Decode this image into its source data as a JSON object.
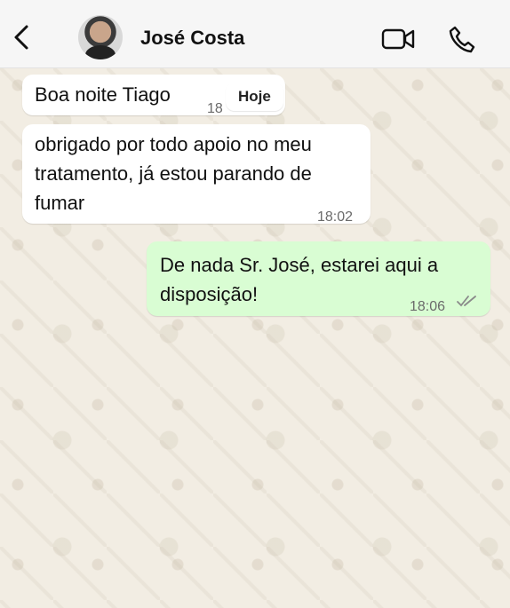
{
  "header": {
    "contact_name": "José Costa",
    "back_icon": "chevron-left-icon",
    "video_icon": "video-camera-icon",
    "call_icon": "phone-icon"
  },
  "date_pill": "Hoje",
  "messages": [
    {
      "direction": "incoming",
      "text": "Boa noite Tiago",
      "time": "18"
    },
    {
      "direction": "incoming",
      "text_lines": [
        "obrigado por todo apoio no meu",
        "tratamento, já estou parando de",
        "fumar"
      ],
      "time": "18:02"
    },
    {
      "direction": "outgoing",
      "text_lines": [
        "De nada Sr. José, estarei aqui a",
        "disposição!"
      ],
      "time": "18:06",
      "status": "read-double-check"
    }
  ],
  "colors": {
    "incoming_bubble": "#ffffff",
    "outgoing_bubble": "#d9fdd3",
    "wallpaper": "#f2ede3",
    "read_ticks": "#8a8a8a"
  }
}
